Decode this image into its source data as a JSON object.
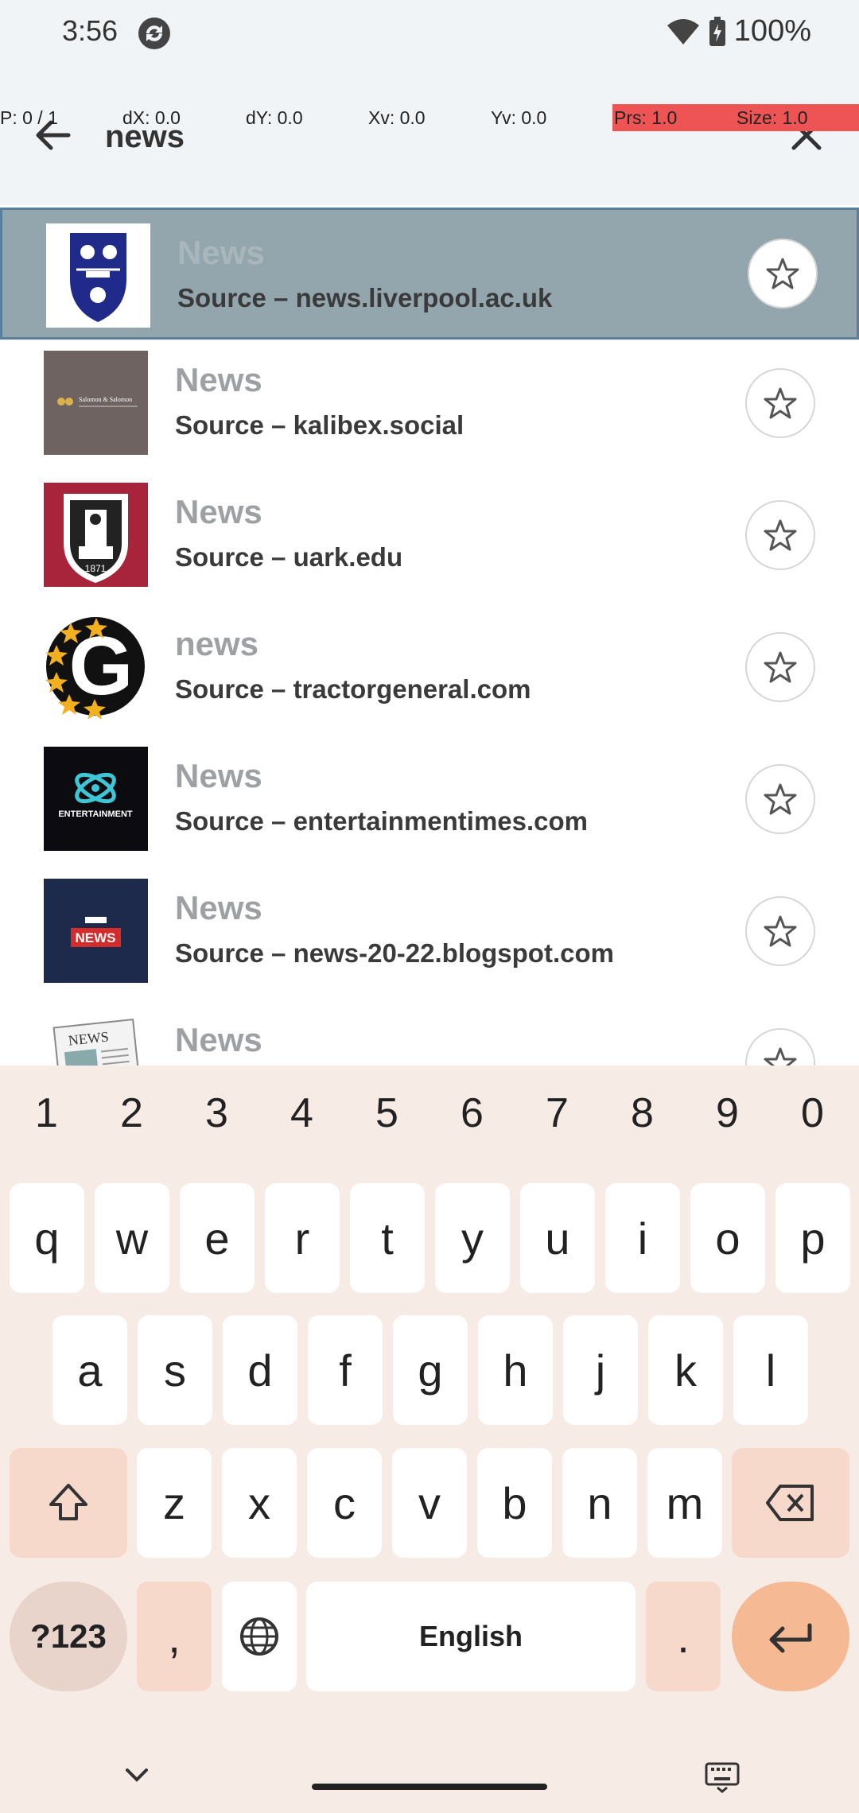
{
  "status_bar": {
    "time": "3:56",
    "battery": "100%"
  },
  "pointer_overlay": {
    "p": "P: 0 / 1",
    "dx": "dX: 0.0",
    "dy": "dY: 0.0",
    "xv": "Xv: 0.0",
    "yv": "Yv: 0.0",
    "prs": "Prs: 1.0",
    "size": "Size: 1.0"
  },
  "search": {
    "query": "news"
  },
  "results": [
    {
      "title": "News",
      "source": "Source – news.liverpool.ac.uk",
      "icon": "shield-crest-icon"
    },
    {
      "title": "News",
      "source": "Source – kalibex.social",
      "icon": "salomon-logo-icon",
      "logo_text": "Salomon & Salomon"
    },
    {
      "title": "News",
      "source": "Source – uark.edu",
      "icon": "tower-crest-icon",
      "logo_text": "1871"
    },
    {
      "title": "news",
      "source": "Source – tractorgeneral.com",
      "icon": "g-stars-icon",
      "logo_text": "G"
    },
    {
      "title": "News",
      "source": "Source – entertainmentimes.com",
      "icon": "entertainment-times-icon",
      "logo_text": "ENTERTAINMENT"
    },
    {
      "title": "News",
      "source": "Source – news-20-22.blogspot.com",
      "icon": "the-news-icon",
      "logo_text": "NEWS"
    },
    {
      "title": "News",
      "source": "",
      "icon": "newspaper-icon",
      "logo_text": "NEWS"
    }
  ],
  "keyboard": {
    "numbers": [
      "1",
      "2",
      "3",
      "4",
      "5",
      "6",
      "7",
      "8",
      "9",
      "0"
    ],
    "row1": [
      "q",
      "w",
      "e",
      "r",
      "t",
      "y",
      "u",
      "i",
      "o",
      "p"
    ],
    "row2": [
      "a",
      "s",
      "d",
      "f",
      "g",
      "h",
      "j",
      "k",
      "l"
    ],
    "row3": [
      "z",
      "x",
      "c",
      "v",
      "b",
      "n",
      "m"
    ],
    "symbols_label": "?123",
    "comma": ",",
    "space_label": "English",
    "period": "."
  }
}
